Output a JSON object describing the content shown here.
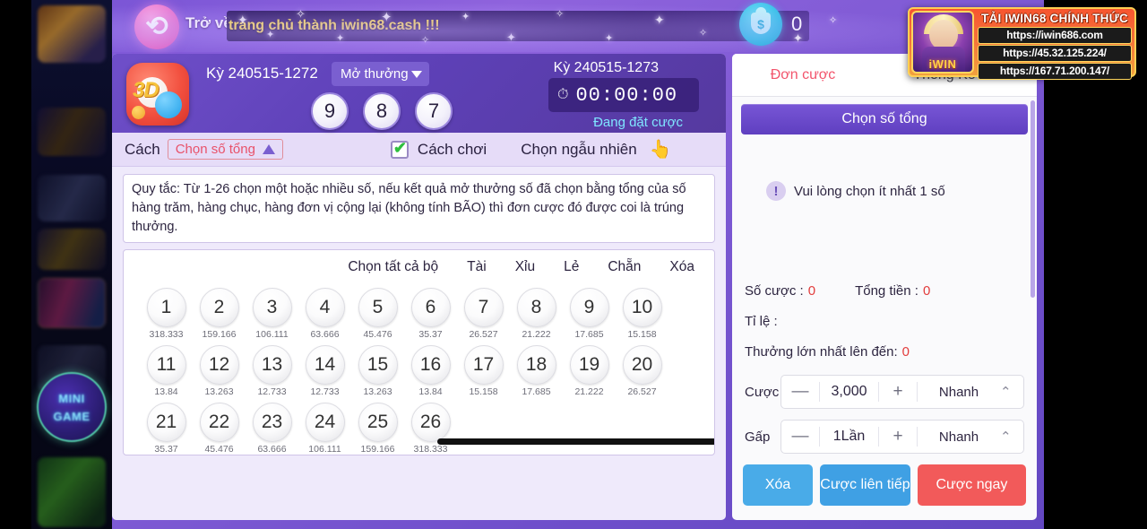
{
  "header": {
    "back_label": "Trở về",
    "marquee": "trang chủ thành iwin68.cash !!!",
    "back_icon": "back-arrow-icon",
    "coin_icon": "money-bag-icon",
    "coin_amount": "0"
  },
  "ad": {
    "title": "TẢI IWIN68 CHÍNH THỨC",
    "urls": [
      "https://iwin686.com",
      "https://45.32.125.224/",
      "https://167.71.200.147/"
    ],
    "logo_text": "iWIN"
  },
  "sidebar": {
    "mini_game_label": "MINI GAME"
  },
  "game": {
    "logo_text": "3D",
    "period_previous_label": "Kỳ 240515-1272",
    "open_prize_label": "Mở thưởng",
    "result_balls": [
      "9",
      "8",
      "7"
    ],
    "period_current_label": "Kỳ 240515-1273",
    "timer": "00:00:00",
    "clock_icon": "alarm-clock-icon",
    "bet_status": "Đang đặt cược"
  },
  "mode_bar": {
    "label": "Cách",
    "chip": "Chọn số tổng",
    "caret_icon": "caret-up-icon",
    "checkbox_icon": "checkbox-checked-icon",
    "how_to_play": "Cách chơi",
    "random_pick": "Chọn ngẫu nhiên",
    "hand_icon": "pointing-hand-icon"
  },
  "rule_text": "Quy tắc: Từ 1-26 chọn một hoặc nhiều số, nếu kết quả mở thưởng số đã chọn bằng tổng của số hàng trăm, hàng chục, hàng đơn vị cộng lại (không tính BÃO) thì đơn cược đó được coi là trúng thưởng.",
  "picker_actions": [
    "Chọn tất cả bộ",
    "Tài",
    "Xỉu",
    "Lẻ",
    "Chẵn",
    "Xóa"
  ],
  "numbers": [
    {
      "n": "1",
      "odds": "318.333"
    },
    {
      "n": "2",
      "odds": "159.166"
    },
    {
      "n": "3",
      "odds": "106.111"
    },
    {
      "n": "4",
      "odds": "63.666"
    },
    {
      "n": "5",
      "odds": "45.476"
    },
    {
      "n": "6",
      "odds": "35.37"
    },
    {
      "n": "7",
      "odds": "26.527"
    },
    {
      "n": "8",
      "odds": "21.222"
    },
    {
      "n": "9",
      "odds": "17.685"
    },
    {
      "n": "10",
      "odds": "15.158"
    },
    {
      "n": "11",
      "odds": "13.84"
    },
    {
      "n": "12",
      "odds": "13.263"
    },
    {
      "n": "13",
      "odds": "12.733"
    },
    {
      "n": "14",
      "odds": "12.733"
    },
    {
      "n": "15",
      "odds": "13.263"
    },
    {
      "n": "16",
      "odds": "13.84"
    },
    {
      "n": "17",
      "odds": "15.158"
    },
    {
      "n": "18",
      "odds": "17.685"
    },
    {
      "n": "19",
      "odds": "21.222"
    },
    {
      "n": "20",
      "odds": "26.527"
    },
    {
      "n": "21",
      "odds": "35.37"
    },
    {
      "n": "22",
      "odds": "45.476"
    },
    {
      "n": "23",
      "odds": "63.666"
    },
    {
      "n": "24",
      "odds": "106.111"
    },
    {
      "n": "25",
      "odds": "159.166"
    },
    {
      "n": "26",
      "odds": "318.333"
    }
  ],
  "bet_panel": {
    "tabs": [
      {
        "label": "Đơn cược",
        "active": true
      },
      {
        "label": "Thống Kê",
        "active": false
      }
    ],
    "bet_type_button": "Chọn số tổng",
    "hint_icon": "exclamation-icon",
    "hint": "Vui lòng chọn ít nhất 1 số",
    "count_label": "Số cược :",
    "count_value": "0",
    "total_label": "Tổng tiền :",
    "total_value": "0",
    "ratio_label": "Tỉ lệ :",
    "ratio_value": "",
    "max_prize_label": "Thưởng lớn nhất lên đến:",
    "max_prize_value": "0",
    "stake": {
      "label": "Cược",
      "minus_icon": "minus-icon",
      "value": "3,000",
      "plus_icon": "plus-icon",
      "quick_label": "Nhanh",
      "caret_icon": "caret-up-icon"
    },
    "multiplier": {
      "label": "Gấp",
      "minus_icon": "minus-icon",
      "value": "1Lần",
      "plus_icon": "plus-icon",
      "quick_label": "Nhanh",
      "caret_icon": "caret-up-icon"
    },
    "actions": {
      "clear": "Xóa",
      "continuous": "Cược liên tiếp",
      "bet_now": "Cược ngay"
    }
  },
  "colors": {
    "accent_purple": "#6f4fc9",
    "accent_red": "#f25a5a",
    "accent_blue": "#49abe8",
    "marquee_yellow": "#ffe24a",
    "status_cyan": "#7fe6ff"
  }
}
